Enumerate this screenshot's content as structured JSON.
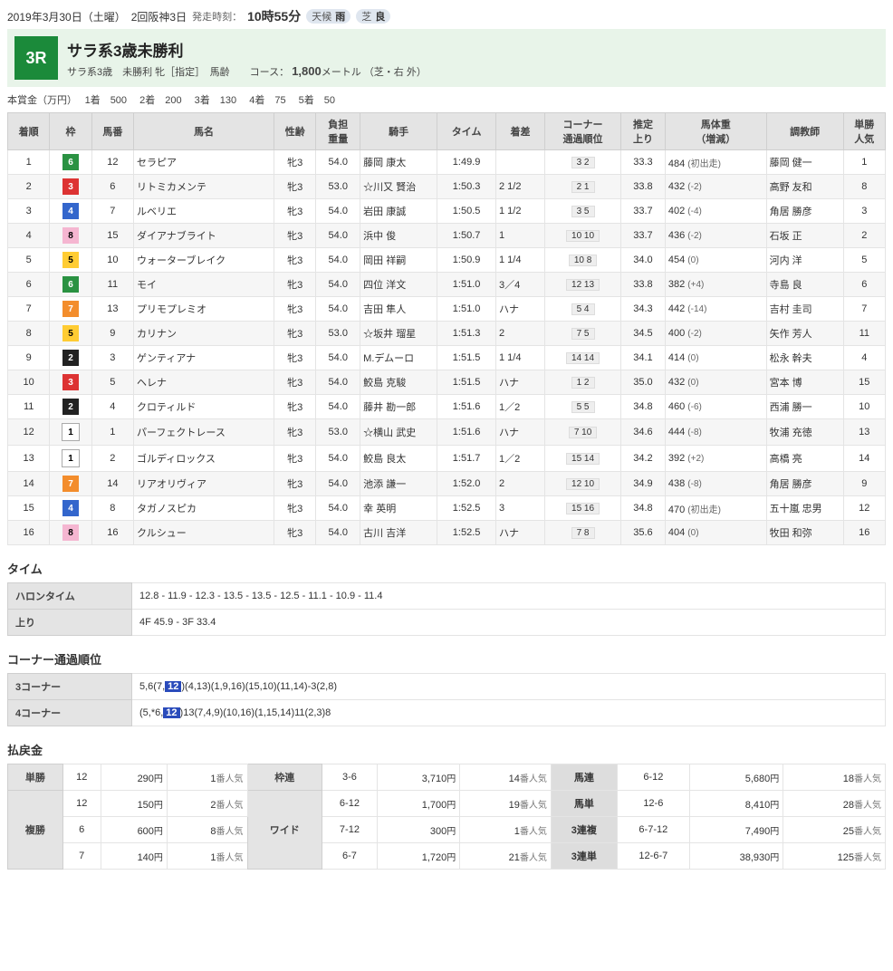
{
  "header": {
    "date": "2019年3月30日（土曜）",
    "meet": "2回阪神3日",
    "startLabel": "発走時刻：",
    "startTime": "10時55分",
    "weatherLabel": "天候",
    "weather": "雨",
    "trackLabel": "芝",
    "track": "良"
  },
  "race": {
    "badge": "3R",
    "title": "サラ系3歳未勝利",
    "subline": "サラ系3歳　未勝利 牝［指定］　馬齢　　コース：",
    "distance": "1,800",
    "distanceUnit": "メートル",
    "courseNote": "（芝・右 外）"
  },
  "prize": {
    "prefix": "本賞金（万円）",
    "p1l": "1着",
    "p1": "500",
    "p2l": "2着",
    "p2": "200",
    "p3l": "3着",
    "p3": "130",
    "p4l": "4着",
    "p4": "75",
    "p5l": "5着",
    "p5": "50"
  },
  "cols": {
    "rank": "着順",
    "waku": "枠",
    "num": "馬番",
    "name": "馬名",
    "sexage": "性齢",
    "weight": "負担\n重量",
    "jockey": "騎手",
    "time": "タイム",
    "margin": "着差",
    "corner": "コーナー\n通過順位",
    "last": "推定\n上り",
    "bw": "馬体重\n（増減）",
    "trainer": "調教師",
    "pop": "単勝\n人気"
  },
  "rows": [
    {
      "rank": "1",
      "waku": "6",
      "num": "12",
      "name": "セラピア",
      "sa": "牝3",
      "w": "54.0",
      "j": "藤岡 康太",
      "t": "1:49.9",
      "m": "",
      "c": "3 2",
      "l": "33.3",
      "bw": "484",
      "bwd": "(初出走)",
      "tr": "藤岡 健一",
      "p": "1"
    },
    {
      "rank": "2",
      "waku": "3",
      "num": "6",
      "name": "リトミカメンテ",
      "sa": "牝3",
      "w": "53.0",
      "j": "☆川又 賢治",
      "t": "1:50.3",
      "m": "2 1/2",
      "c": "2 1",
      "l": "33.8",
      "bw": "432",
      "bwd": "(-2)",
      "tr": "高野 友和",
      "p": "8"
    },
    {
      "rank": "3",
      "waku": "4",
      "num": "7",
      "name": "ルベリエ",
      "sa": "牝3",
      "w": "54.0",
      "j": "岩田 康誠",
      "t": "1:50.5",
      "m": "1 1/2",
      "c": "3 5",
      "l": "33.7",
      "bw": "402",
      "bwd": "(-4)",
      "tr": "角居 勝彦",
      "p": "3"
    },
    {
      "rank": "4",
      "waku": "8",
      "num": "15",
      "name": "ダイアナブライト",
      "sa": "牝3",
      "w": "54.0",
      "j": "浜中 俊",
      "t": "1:50.7",
      "m": "1",
      "c": "10 10",
      "l": "33.7",
      "bw": "436",
      "bwd": "(-2)",
      "tr": "石坂 正",
      "p": "2"
    },
    {
      "rank": "5",
      "waku": "5",
      "num": "10",
      "name": "ウォーターブレイク",
      "sa": "牝3",
      "w": "54.0",
      "j": "岡田 祥嗣",
      "t": "1:50.9",
      "m": "1 1/4",
      "c": "10 8",
      "l": "34.0",
      "bw": "454",
      "bwd": "(0)",
      "tr": "河内 洋",
      "p": "5"
    },
    {
      "rank": "6",
      "waku": "6",
      "num": "11",
      "name": "モイ",
      "sa": "牝3",
      "w": "54.0",
      "j": "四位 洋文",
      "t": "1:51.0",
      "m": "3／4",
      "c": "12 13",
      "l": "33.8",
      "bw": "382",
      "bwd": "(+4)",
      "tr": "寺島 良",
      "p": "6"
    },
    {
      "rank": "7",
      "waku": "7",
      "num": "13",
      "name": "プリモプレミオ",
      "sa": "牝3",
      "w": "54.0",
      "j": "吉田 隼人",
      "t": "1:51.0",
      "m": "ハナ",
      "c": "5 4",
      "l": "34.3",
      "bw": "442",
      "bwd": "(-14)",
      "tr": "吉村 圭司",
      "p": "7"
    },
    {
      "rank": "8",
      "waku": "5",
      "num": "9",
      "name": "カリナン",
      "sa": "牝3",
      "w": "53.0",
      "j": "☆坂井 瑠星",
      "t": "1:51.3",
      "m": "2",
      "c": "7 5",
      "l": "34.5",
      "bw": "400",
      "bwd": "(-2)",
      "tr": "矢作 芳人",
      "p": "11"
    },
    {
      "rank": "9",
      "waku": "2",
      "num": "3",
      "name": "ゲンティアナ",
      "sa": "牝3",
      "w": "54.0",
      "j": "M.デムーロ",
      "t": "1:51.5",
      "m": "1 1/4",
      "c": "14 14",
      "l": "34.1",
      "bw": "414",
      "bwd": "(0)",
      "tr": "松永 幹夫",
      "p": "4"
    },
    {
      "rank": "10",
      "waku": "3",
      "num": "5",
      "name": "ヘレナ",
      "sa": "牝3",
      "w": "54.0",
      "j": "鮫島 克駿",
      "t": "1:51.5",
      "m": "ハナ",
      "c": "1 2",
      "l": "35.0",
      "bw": "432",
      "bwd": "(0)",
      "tr": "宮本 博",
      "p": "15"
    },
    {
      "rank": "11",
      "waku": "2",
      "num": "4",
      "name": "クロティルド",
      "sa": "牝3",
      "w": "54.0",
      "j": "藤井 勘一郎",
      "t": "1:51.6",
      "m": "1／2",
      "c": "5 5",
      "l": "34.8",
      "bw": "460",
      "bwd": "(-6)",
      "tr": "西浦 勝一",
      "p": "10"
    },
    {
      "rank": "12",
      "waku": "1",
      "num": "1",
      "name": "パーフェクトレース",
      "sa": "牝3",
      "w": "53.0",
      "j": "☆横山 武史",
      "t": "1:51.6",
      "m": "ハナ",
      "c": "7 10",
      "l": "34.6",
      "bw": "444",
      "bwd": "(-8)",
      "tr": "牧浦 充徳",
      "p": "13"
    },
    {
      "rank": "13",
      "waku": "1",
      "num": "2",
      "name": "ゴルディロックス",
      "sa": "牝3",
      "w": "54.0",
      "j": "鮫島 良太",
      "t": "1:51.7",
      "m": "1／2",
      "c": "15 14",
      "l": "34.2",
      "bw": "392",
      "bwd": "(+2)",
      "tr": "高橋 亮",
      "p": "14"
    },
    {
      "rank": "14",
      "waku": "7",
      "num": "14",
      "name": "リアオリヴィア",
      "sa": "牝3",
      "w": "54.0",
      "j": "池添 謙一",
      "t": "1:52.0",
      "m": "2",
      "c": "12 10",
      "l": "34.9",
      "bw": "438",
      "bwd": "(-8)",
      "tr": "角居 勝彦",
      "p": "9"
    },
    {
      "rank": "15",
      "waku": "4",
      "num": "8",
      "name": "タガノスピカ",
      "sa": "牝3",
      "w": "54.0",
      "j": "幸 英明",
      "t": "1:52.5",
      "m": "3",
      "c": "15 16",
      "l": "34.8",
      "bw": "470",
      "bwd": "(初出走)",
      "tr": "五十嵐 忠男",
      "p": "12"
    },
    {
      "rank": "16",
      "waku": "8",
      "num": "16",
      "name": "クルシュー",
      "sa": "牝3",
      "w": "54.0",
      "j": "古川 吉洋",
      "t": "1:52.5",
      "m": "ハナ",
      "c": "7 8",
      "l": "35.6",
      "bw": "404",
      "bwd": "(0)",
      "tr": "牧田 和弥",
      "p": "16"
    }
  ],
  "time": {
    "sectionTitle": "タイム",
    "furlongLabel": "ハロンタイム",
    "furlong": "12.8 - 11.9 - 12.3 - 13.5 - 13.5 - 12.5 - 11.1 - 10.9 - 11.4",
    "agariLabel": "上り",
    "agari": "4F 45.9 - 3F 33.4"
  },
  "corner": {
    "sectionTitle": "コーナー通過順位",
    "c3Label": "3コーナー",
    "c3a": "5,6(7,",
    "c3b": "12",
    "c3c": ")(4,13)(1,9,16)(15,10)(11,14)-3(2,8)",
    "c4Label": "4コーナー",
    "c4a": "(5,*6,",
    "c4b": "12",
    "c4c": ")13(7,4,9)(10,16)(1,15,14)11(2,3)8"
  },
  "payout": {
    "sectionTitle": "払戻金",
    "labels": {
      "tansho": "単勝",
      "fukusho": "複勝",
      "wakuren": "枠連",
      "wide": "ワイド",
      "umaren": "馬連",
      "umatan": "馬単",
      "sanpuku": "3連複",
      "santan": "3連単"
    },
    "tansho": {
      "num": "12",
      "yen": "290",
      "pop": "1"
    },
    "fukusho": [
      {
        "num": "12",
        "yen": "150",
        "pop": "2"
      },
      {
        "num": "6",
        "yen": "600",
        "pop": "8"
      },
      {
        "num": "7",
        "yen": "140",
        "pop": "1"
      }
    ],
    "wakuren": {
      "num": "3-6",
      "yen": "3,710",
      "pop": "14"
    },
    "wide": [
      {
        "num": "6-12",
        "yen": "1,700",
        "pop": "19"
      },
      {
        "num": "7-12",
        "yen": "300",
        "pop": "1"
      },
      {
        "num": "6-7",
        "yen": "1,720",
        "pop": "21"
      }
    ],
    "umaren": {
      "num": "6-12",
      "yen": "5,680",
      "pop": "18"
    },
    "umatan": {
      "num": "12-6",
      "yen": "8,410",
      "pop": "28"
    },
    "sanpuku": {
      "num": "6-7-12",
      "yen": "7,490",
      "pop": "25"
    },
    "santan": {
      "num": "12-6-7",
      "yen": "38,930",
      "pop": "125"
    }
  }
}
